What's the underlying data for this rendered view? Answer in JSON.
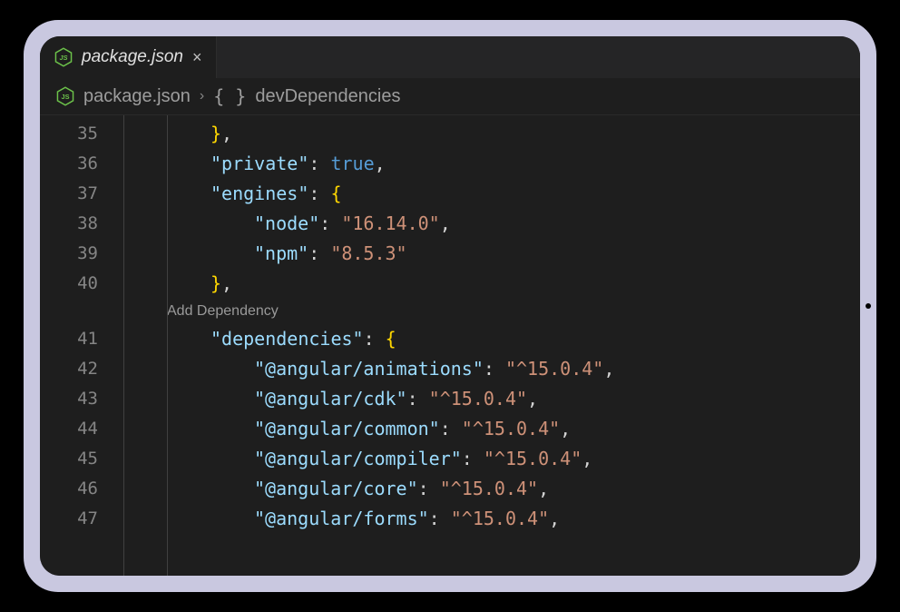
{
  "tab": {
    "filename": "package.json",
    "close_glyph": "×"
  },
  "breadcrumb": {
    "file": "package.json",
    "chevron": "›",
    "braces": "{ }",
    "section": "devDependencies"
  },
  "codelens": {
    "add_dependency": "Add Dependency"
  },
  "lines": {
    "l35": {
      "num": "35",
      "brace": "}",
      "comma": ","
    },
    "l36": {
      "num": "36",
      "key": "\"private\"",
      "colon": ":",
      "val": "true",
      "comma": ","
    },
    "l37": {
      "num": "37",
      "key": "\"engines\"",
      "colon": ":",
      "brace": "{"
    },
    "l38": {
      "num": "38",
      "key": "\"node\"",
      "colon": ":",
      "val": "\"16.14.0\"",
      "comma": ","
    },
    "l39": {
      "num": "39",
      "key": "\"npm\"",
      "colon": ":",
      "val": "\"8.5.3\""
    },
    "l40": {
      "num": "40",
      "brace": "}",
      "comma": ","
    },
    "l41": {
      "num": "41",
      "key": "\"dependencies\"",
      "colon": ":",
      "brace": "{"
    },
    "l42": {
      "num": "42",
      "key": "\"@angular/animations\"",
      "colon": ":",
      "val": "\"^15.0.4\"",
      "comma": ","
    },
    "l43": {
      "num": "43",
      "key": "\"@angular/cdk\"",
      "colon": ":",
      "val": "\"^15.0.4\"",
      "comma": ","
    },
    "l44": {
      "num": "44",
      "key": "\"@angular/common\"",
      "colon": ":",
      "val": "\"^15.0.4\"",
      "comma": ","
    },
    "l45": {
      "num": "45",
      "key": "\"@angular/compiler\"",
      "colon": ":",
      "val": "\"^15.0.4\"",
      "comma": ","
    },
    "l46": {
      "num": "46",
      "key": "\"@angular/core\"",
      "colon": ":",
      "val": "\"^15.0.4\"",
      "comma": ","
    },
    "l47": {
      "num": "47",
      "key": "\"@angular/forms\"",
      "colon": ":",
      "val": "\"^15.0.4\"",
      "comma": ","
    }
  }
}
